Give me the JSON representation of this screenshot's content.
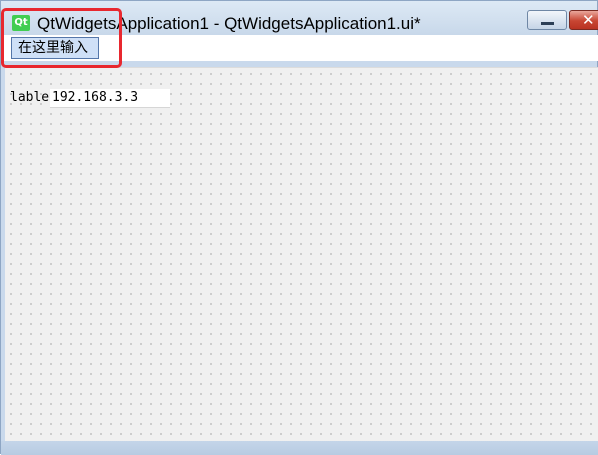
{
  "window": {
    "logo_text": "Qt",
    "title": "QtWidgetsApplication1 - QtWidgetsApplication1.ui*",
    "close_glyph": "✕"
  },
  "menubar": {
    "items": [
      {
        "label": "在这里输入"
      }
    ]
  },
  "form": {
    "label_text": "lable",
    "lineedit_value": "192.168.3.3"
  },
  "colors": {
    "highlight_border": "#e8282f",
    "close_button": "#c84532",
    "qt_green": "#41cd52"
  }
}
